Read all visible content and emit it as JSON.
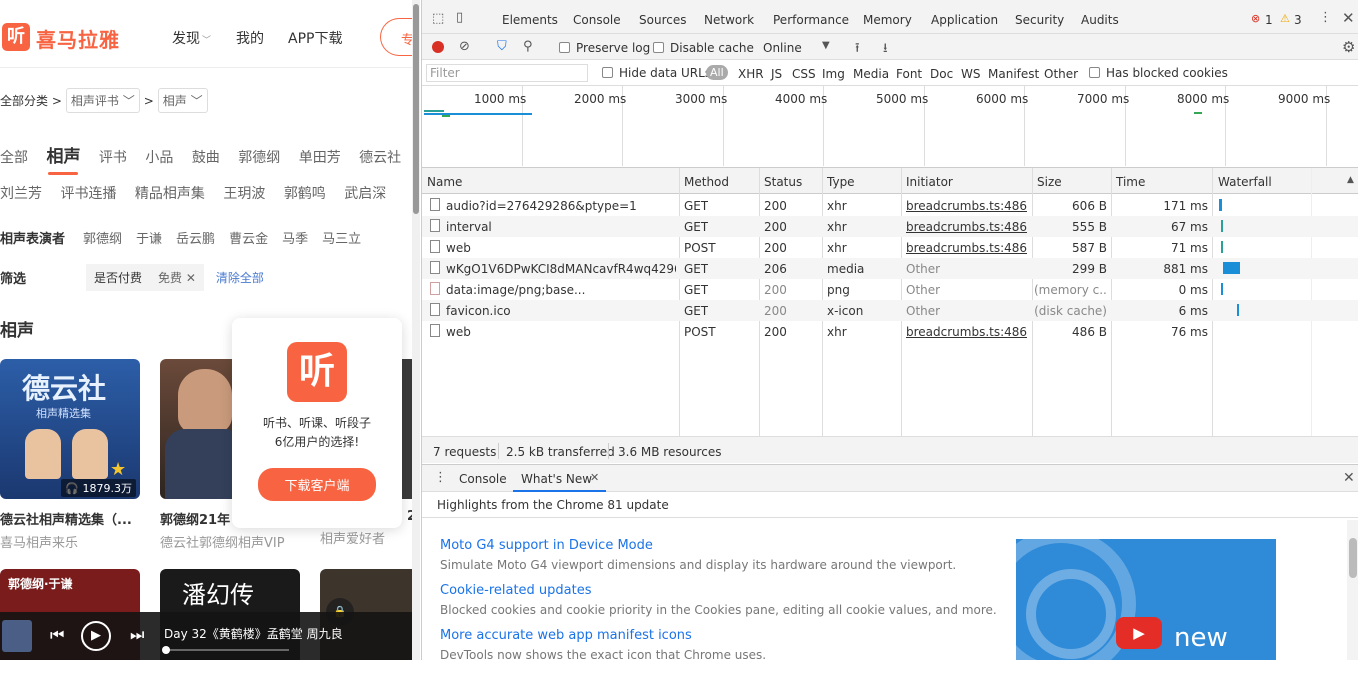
{
  "site": {
    "logo_glyph": "听",
    "logo_text": "喜马拉雅",
    "nav": [
      "发现",
      "我的",
      "APP下载"
    ],
    "nav_chevron": "﹀",
    "search_hint": "专"
  },
  "breadcrumb": {
    "root": "全部分类 >",
    "level1": "相声评书 ﹀",
    "sep": ">",
    "level2": "相声 ﹀"
  },
  "categories_row1": {
    "all": "全部",
    "active": "相声",
    "items": [
      "评书",
      "小品",
      "鼓曲",
      "郭德纲",
      "单田芳",
      "德云社"
    ]
  },
  "categories_row2": [
    "刘兰芳",
    "评书连播",
    "精品相声集",
    "王玥波",
    "郭鹤鸣",
    "武启深"
  ],
  "performers": {
    "label": "相声表演者",
    "items": [
      "郭德纲",
      "于谦",
      "岳云鹏",
      "曹云金",
      "马季",
      "马三立"
    ]
  },
  "filters": {
    "label": "筛选",
    "chip1": "是否付费",
    "chip2": "免费 ✕",
    "clear": "清除全部"
  },
  "section_title": "相声",
  "cards": [
    {
      "title": "德云社相声精选集（...",
      "subtitle": "喜马相声来乐",
      "plays": "1879.3万",
      "cover_text": "德云社",
      "cover_sub": "相声精选集"
    },
    {
      "title": "郭德纲21年",
      "subtitle": "德云社郭德纲相声VIP",
      "plays": "",
      "cover_text": "",
      "cover_sub": ""
    },
    {
      "title": "2",
      "subtitle": "相声爱好者",
      "plays": "",
      "cover_text": "",
      "cover_sub": ""
    }
  ],
  "cards_row2": [
    {
      "cover_text": "郭德纲·于谦"
    },
    {
      "cover_text": "潘幻传"
    },
    {
      "cover_text": ""
    }
  ],
  "popup": {
    "icon": "听",
    "line1": "听书、听课、听段子",
    "line2": "6亿用户的选择!",
    "button": "下载客户端"
  },
  "player": {
    "title": "Day 32《黄鹤楼》孟鹤堂 周九良",
    "progress": 0.0
  },
  "devtools": {
    "tabs": [
      "Elements",
      "Console",
      "Sources",
      "Network",
      "Performance",
      "Memory",
      "Application",
      "Security",
      "Audits"
    ],
    "active_tab": "Network",
    "errors": "1",
    "warnings": "3",
    "toolbar": {
      "preserve_log": "Preserve log",
      "disable_cache": "Disable cache",
      "throttle": "Online"
    },
    "filter": {
      "placeholder": "Filter",
      "hide_data_urls": "Hide data URLs",
      "all": "All",
      "types": [
        "XHR",
        "JS",
        "CSS",
        "Img",
        "Media",
        "Font",
        "Doc",
        "WS",
        "Manifest",
        "Other"
      ],
      "blocked_cookies": "Has blocked cookies"
    },
    "overview_ticks": [
      "1000 ms",
      "2000 ms",
      "3000 ms",
      "4000 ms",
      "5000 ms",
      "6000 ms",
      "7000 ms",
      "8000 ms",
      "9000 ms"
    ],
    "columns": [
      "Name",
      "Method",
      "Status",
      "Type",
      "Initiator",
      "Size",
      "Time",
      "Waterfall"
    ],
    "requests": [
      {
        "name": "audio?id=276429286&ptype=1",
        "method": "GET",
        "status": "200",
        "type": "xhr",
        "initiator": "breadcrumbs.ts:486",
        "size": "606 B",
        "time": "171 ms"
      },
      {
        "name": "interval",
        "method": "GET",
        "status": "200",
        "type": "xhr",
        "initiator": "breadcrumbs.ts:486",
        "size": "555 B",
        "time": "67 ms"
      },
      {
        "name": "web",
        "method": "POST",
        "status": "200",
        "type": "xhr",
        "initiator": "breadcrumbs.ts:486",
        "size": "587 B",
        "time": "71 ms"
      },
      {
        "name": "wKgO1V6DPwKCI8dMANcavfR4wq4296....",
        "method": "GET",
        "status": "206",
        "type": "media",
        "initiator": "Other",
        "size": "299 B",
        "time": "881 ms"
      },
      {
        "name": "data:image/png;base...",
        "method": "GET",
        "status": "200",
        "type": "png",
        "initiator": "Other",
        "size": "(memory c...",
        "time": "0 ms"
      },
      {
        "name": "favicon.ico",
        "method": "GET",
        "status": "200",
        "type": "x-icon",
        "initiator": "Other",
        "size": "(disk cache)",
        "time": "6 ms"
      },
      {
        "name": "web",
        "method": "POST",
        "status": "200",
        "type": "xhr",
        "initiator": "breadcrumbs.ts:486",
        "size": "486 B",
        "time": "76 ms"
      }
    ],
    "summary": {
      "requests": "7 requests",
      "transferred": "2.5 kB transferred",
      "resources": "3.6 MB resources"
    },
    "drawer": {
      "tabs": [
        "Console",
        "What's New"
      ],
      "active": "What's New",
      "close_glyph": "✕",
      "highlights": "Highlights from the Chrome 81 update",
      "items": [
        {
          "title": "Moto G4 support in Device Mode",
          "desc": "Simulate Moto G4 viewport dimensions and display its hardware around the viewport."
        },
        {
          "title": "Cookie-related updates",
          "desc": "Blocked cookies and cookie priority in the Cookies pane, editing all cookie values, and more."
        },
        {
          "title": "More accurate web app manifest icons",
          "desc": "DevTools now shows the exact icon that Chrome uses."
        }
      ],
      "image_text": "new"
    }
  }
}
